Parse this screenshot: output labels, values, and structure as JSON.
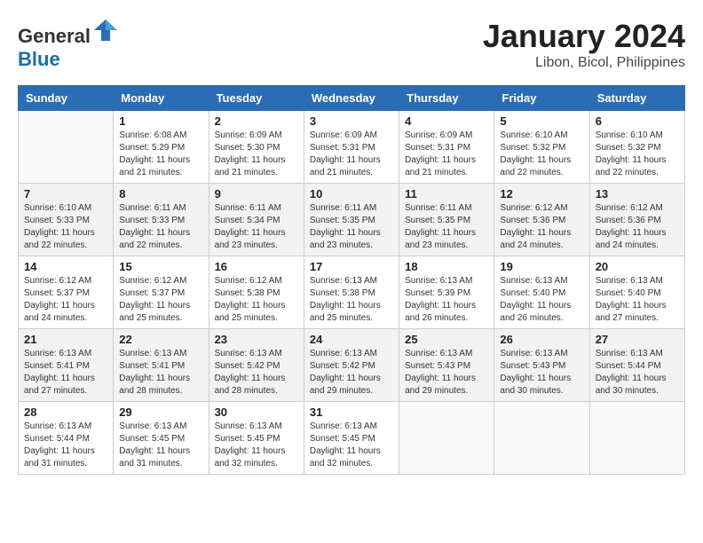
{
  "header": {
    "logo_general": "General",
    "logo_blue": "Blue",
    "month_year": "January 2024",
    "location": "Libon, Bicol, Philippines"
  },
  "days_of_week": [
    "Sunday",
    "Monday",
    "Tuesday",
    "Wednesday",
    "Thursday",
    "Friday",
    "Saturday"
  ],
  "weeks": [
    [
      {
        "day": "",
        "sunrise": "",
        "sunset": "",
        "daylight": ""
      },
      {
        "day": "1",
        "sunrise": "6:08 AM",
        "sunset": "5:29 PM",
        "daylight": "11 hours and 21 minutes."
      },
      {
        "day": "2",
        "sunrise": "6:09 AM",
        "sunset": "5:30 PM",
        "daylight": "11 hours and 21 minutes."
      },
      {
        "day": "3",
        "sunrise": "6:09 AM",
        "sunset": "5:31 PM",
        "daylight": "11 hours and 21 minutes."
      },
      {
        "day": "4",
        "sunrise": "6:09 AM",
        "sunset": "5:31 PM",
        "daylight": "11 hours and 21 minutes."
      },
      {
        "day": "5",
        "sunrise": "6:10 AM",
        "sunset": "5:32 PM",
        "daylight": "11 hours and 22 minutes."
      },
      {
        "day": "6",
        "sunrise": "6:10 AM",
        "sunset": "5:32 PM",
        "daylight": "11 hours and 22 minutes."
      }
    ],
    [
      {
        "day": "7",
        "sunrise": "6:10 AM",
        "sunset": "5:33 PM",
        "daylight": "11 hours and 22 minutes."
      },
      {
        "day": "8",
        "sunrise": "6:11 AM",
        "sunset": "5:33 PM",
        "daylight": "11 hours and 22 minutes."
      },
      {
        "day": "9",
        "sunrise": "6:11 AM",
        "sunset": "5:34 PM",
        "daylight": "11 hours and 23 minutes."
      },
      {
        "day": "10",
        "sunrise": "6:11 AM",
        "sunset": "5:35 PM",
        "daylight": "11 hours and 23 minutes."
      },
      {
        "day": "11",
        "sunrise": "6:11 AM",
        "sunset": "5:35 PM",
        "daylight": "11 hours and 23 minutes."
      },
      {
        "day": "12",
        "sunrise": "6:12 AM",
        "sunset": "5:36 PM",
        "daylight": "11 hours and 24 minutes."
      },
      {
        "day": "13",
        "sunrise": "6:12 AM",
        "sunset": "5:36 PM",
        "daylight": "11 hours and 24 minutes."
      }
    ],
    [
      {
        "day": "14",
        "sunrise": "6:12 AM",
        "sunset": "5:37 PM",
        "daylight": "11 hours and 24 minutes."
      },
      {
        "day": "15",
        "sunrise": "6:12 AM",
        "sunset": "5:37 PM",
        "daylight": "11 hours and 25 minutes."
      },
      {
        "day": "16",
        "sunrise": "6:12 AM",
        "sunset": "5:38 PM",
        "daylight": "11 hours and 25 minutes."
      },
      {
        "day": "17",
        "sunrise": "6:13 AM",
        "sunset": "5:38 PM",
        "daylight": "11 hours and 25 minutes."
      },
      {
        "day": "18",
        "sunrise": "6:13 AM",
        "sunset": "5:39 PM",
        "daylight": "11 hours and 26 minutes."
      },
      {
        "day": "19",
        "sunrise": "6:13 AM",
        "sunset": "5:40 PM",
        "daylight": "11 hours and 26 minutes."
      },
      {
        "day": "20",
        "sunrise": "6:13 AM",
        "sunset": "5:40 PM",
        "daylight": "11 hours and 27 minutes."
      }
    ],
    [
      {
        "day": "21",
        "sunrise": "6:13 AM",
        "sunset": "5:41 PM",
        "daylight": "11 hours and 27 minutes."
      },
      {
        "day": "22",
        "sunrise": "6:13 AM",
        "sunset": "5:41 PM",
        "daylight": "11 hours and 28 minutes."
      },
      {
        "day": "23",
        "sunrise": "6:13 AM",
        "sunset": "5:42 PM",
        "daylight": "11 hours and 28 minutes."
      },
      {
        "day": "24",
        "sunrise": "6:13 AM",
        "sunset": "5:42 PM",
        "daylight": "11 hours and 29 minutes."
      },
      {
        "day": "25",
        "sunrise": "6:13 AM",
        "sunset": "5:43 PM",
        "daylight": "11 hours and 29 minutes."
      },
      {
        "day": "26",
        "sunrise": "6:13 AM",
        "sunset": "5:43 PM",
        "daylight": "11 hours and 30 minutes."
      },
      {
        "day": "27",
        "sunrise": "6:13 AM",
        "sunset": "5:44 PM",
        "daylight": "11 hours and 30 minutes."
      }
    ],
    [
      {
        "day": "28",
        "sunrise": "6:13 AM",
        "sunset": "5:44 PM",
        "daylight": "11 hours and 31 minutes."
      },
      {
        "day": "29",
        "sunrise": "6:13 AM",
        "sunset": "5:45 PM",
        "daylight": "11 hours and 31 minutes."
      },
      {
        "day": "30",
        "sunrise": "6:13 AM",
        "sunset": "5:45 PM",
        "daylight": "11 hours and 32 minutes."
      },
      {
        "day": "31",
        "sunrise": "6:13 AM",
        "sunset": "5:45 PM",
        "daylight": "11 hours and 32 minutes."
      },
      {
        "day": "",
        "sunrise": "",
        "sunset": "",
        "daylight": ""
      },
      {
        "day": "",
        "sunrise": "",
        "sunset": "",
        "daylight": ""
      },
      {
        "day": "",
        "sunrise": "",
        "sunset": "",
        "daylight": ""
      }
    ]
  ],
  "labels": {
    "sunrise_prefix": "Sunrise: ",
    "sunset_prefix": "Sunset: ",
    "daylight_prefix": "Daylight: "
  }
}
